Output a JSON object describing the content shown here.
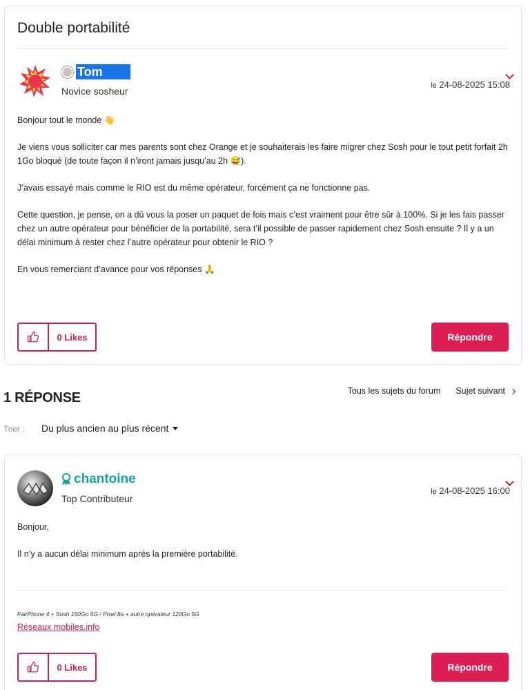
{
  "thread": {
    "title": "Double portabilité"
  },
  "post1": {
    "author": "Tom",
    "rank": "Novice sosheur",
    "date_prefix": "le",
    "date": "24-08-2025 15:08",
    "paragraphs": [
      "Bonjour tout le monde 👋",
      "Je viens vous solliciter car mes parents sont chez Orange et je souhaiterais les faire migrer chez Sosh pour le tout petit forfait 2h 1Go bloqué (de toute façon il n’iront jamais jusqu’au 2h 😅).",
      "J’avais essayé mais comme le RIO est du même opérateur, forcément ça ne fonctionne pas.",
      "Cette question, je pense, on a dû vous la poser un paquet de fois mais c’est vraiment pour être sûr à 100%. Si je les fais passer chez un autre opérateur pour bénéficier de la portabilité, sera t’il possible de passer rapidement chez Sosh ensuite ? Il y a un délai minimum à rester chez l’autre opérateur pour obtenir le RIO ?",
      "En vous remerciant d’avance pour vos réponses 🙏"
    ],
    "likes_label": "0 Likes",
    "reply_label": "Répondre"
  },
  "replies_bar": {
    "heading": "1 RÉPONSE",
    "all_topics": "Tous les sujets du forum",
    "next_topic": "Sujet suivant",
    "sort_label": "Trier :",
    "sort_value": "Du plus ancien au plus récent"
  },
  "post2": {
    "author": "chantoine",
    "rank": "Top Contributeur",
    "date_prefix": "le",
    "date": "24-08-2025 16:00",
    "paragraphs": [
      "Bonjour,",
      "Il n’y a aucun délai minimum après la première portabilité."
    ],
    "signature": "FairPhone 4 + Sosh 150Go 5G / Pixel 8a + autre opérateur 120Go 5G",
    "signature_link": "Réseaux mobiles.info",
    "likes_label": "0 Likes",
    "reply_label": "Répondre"
  },
  "colors": {
    "accent": "#dc1e55",
    "accent_border": "#c8234b",
    "contributor": "#15a39d",
    "selection": "#1a73e8"
  }
}
